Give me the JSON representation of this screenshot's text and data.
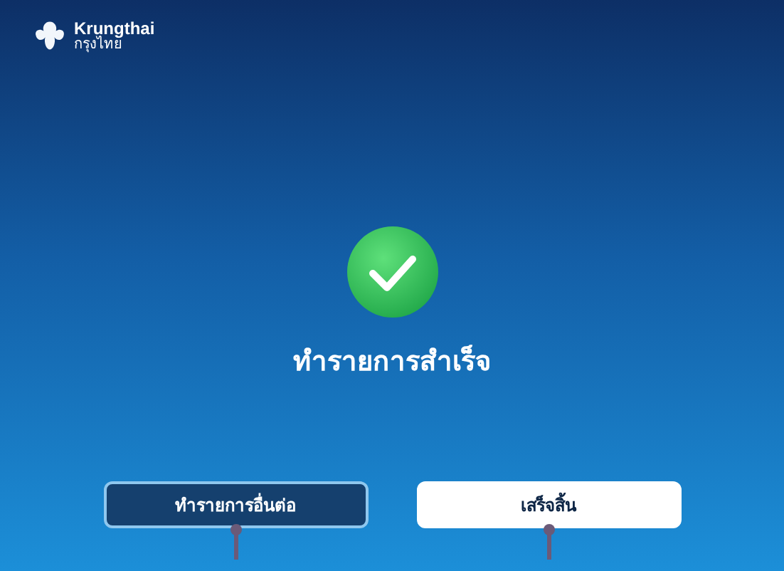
{
  "header": {
    "brand": "Krungthai",
    "brand_thai": "กรุงไทย"
  },
  "result": {
    "success": true,
    "message": "ทำรายการสำเร็จ"
  },
  "buttons": [
    {
      "label": "ทำรายการอื่นต่อ",
      "kind": "secondary"
    },
    {
      "label": "เสร็จสิ้น",
      "kind": "primary"
    }
  ]
}
